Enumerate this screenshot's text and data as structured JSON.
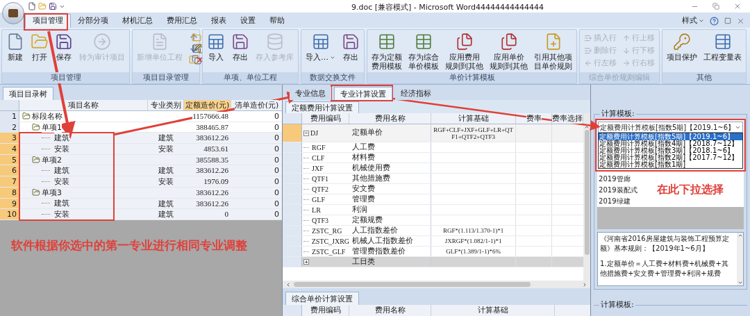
{
  "window": {
    "title": "9.doc [兼容模式] - Microsoft Word44444444444444",
    "style_menu": "样式"
  },
  "menu_tabs": [
    {
      "label": "项目管理",
      "selected": true
    },
    {
      "label": "分部分项",
      "selected": false
    },
    {
      "label": "材机汇总",
      "selected": false
    },
    {
      "label": "费用汇总",
      "selected": false
    },
    {
      "label": "报表",
      "selected": false
    },
    {
      "label": "设置",
      "selected": false
    },
    {
      "label": "帮助",
      "selected": false
    }
  ],
  "ribbon_groups": [
    {
      "label": "项目管理",
      "disabled": false,
      "buttons": [
        {
          "kind": "new",
          "lines": [
            "新建"
          ],
          "disabled": false
        },
        {
          "kind": "open",
          "lines": [
            "打开"
          ],
          "disabled": false
        },
        {
          "kind": "save",
          "lines": [
            "保存"
          ],
          "disabled": false
        },
        {
          "kind": "convert",
          "lines": [
            "转为审计项目"
          ],
          "disabled": true
        }
      ]
    },
    {
      "label": "项目目录管理",
      "disabled": false,
      "buttons": [
        {
          "kind": "new-unit",
          "lines": [
            "新增单位工程"
          ],
          "disabled": true
        }
      ]
    },
    {
      "label": "单项、单位工程",
      "disabled": false,
      "buttons": [
        {
          "kind": "import",
          "lines": [
            "导入"
          ],
          "disabled": false
        },
        {
          "kind": "export",
          "lines": [
            "存出"
          ],
          "disabled": false
        },
        {
          "kind": "library",
          "lines": [
            "存入参考库"
          ],
          "disabled": true
        }
      ]
    },
    {
      "label": "数据交换文件",
      "disabled": false,
      "buttons": [
        {
          "kind": "import",
          "lines": [
            "导入…"
          ],
          "disabled": false,
          "dropdown": true
        },
        {
          "kind": "export",
          "lines": [
            "存出"
          ],
          "disabled": false
        }
      ]
    },
    {
      "label": "单价计算模板",
      "disabled": false,
      "buttons": [
        {
          "kind": "template",
          "lines": [
            "存为定额",
            "费用模板"
          ],
          "disabled": false
        },
        {
          "kind": "template",
          "lines": [
            "存为综合",
            "单价模板"
          ],
          "disabled": false
        },
        {
          "kind": "rule",
          "lines": [
            "应用费用",
            "规则到其他"
          ],
          "disabled": false
        },
        {
          "kind": "rule",
          "lines": [
            "应用单价",
            "规则到其他"
          ],
          "disabled": false
        },
        {
          "kind": "reference",
          "lines": [
            "引用其他项",
            "目单价规则"
          ],
          "disabled": false
        }
      ]
    },
    {
      "label": "综合单价规则编辑",
      "disabled": true,
      "small": [
        {
          "kind": "insert-row",
          "label": "插入行",
          "disabled": true
        },
        {
          "kind": "delete-row",
          "label": "删除行",
          "disabled": true
        },
        {
          "kind": "move-left",
          "label": "行左移",
          "disabled": true
        },
        {
          "kind": "move-up",
          "label": "行上移",
          "disabled": true
        },
        {
          "kind": "move-down",
          "label": "行下移",
          "disabled": true
        },
        {
          "kind": "move-right",
          "label": "行右移",
          "disabled": true
        }
      ]
    },
    {
      "label": "其他",
      "disabled": false,
      "buttons": [
        {
          "kind": "protect",
          "lines": [
            "项目保护"
          ],
          "disabled": false
        },
        {
          "kind": "variables",
          "lines": [
            "工程变量表"
          ],
          "disabled": false
        }
      ]
    }
  ],
  "project_tree": {
    "tab": "项目目录树",
    "columns": [
      "项目名称",
      "专业类别",
      "定额造价(元)",
      "清单造价(元)"
    ],
    "rows": [
      {
        "no": "1",
        "name": "标段名称",
        "quota": "1157666.48",
        "list": "0",
        "selected": false,
        "children": [
          {
            "no": "2",
            "name": "单项1",
            "quota": "388465.87",
            "list": "0",
            "selected": false,
            "children": [
              {
                "no": "3",
                "name": "建筑",
                "type": "建筑",
                "quota": "383612.26",
                "list": "0",
                "selected": true
              },
              {
                "no": "4",
                "name": "安装",
                "type": "安装",
                "quota": "4853.61",
                "list": "0",
                "selected": true
              }
            ]
          },
          {
            "no": "5",
            "name": "单项2",
            "quota": "385588.35",
            "list": "0",
            "selected": true,
            "children": [
              {
                "no": "6",
                "name": "建筑",
                "type": "建筑",
                "quota": "383612.26",
                "list": "0",
                "selected": true
              },
              {
                "no": "7",
                "name": "安装",
                "type": "安装",
                "quota": "1976.09",
                "list": "0",
                "selected": true
              }
            ]
          },
          {
            "no": "8",
            "name": "单项3",
            "quota": "383612.26",
            "list": "0",
            "selected": true,
            "children": [
              {
                "no": "9",
                "name": "建筑",
                "type": "建筑",
                "quota": "383612.26",
                "list": "0",
                "selected": true
              },
              {
                "no": "10",
                "name": "安装",
                "type": "建筑",
                "quota": "0",
                "list": "0",
                "selected": true
              }
            ]
          }
        ]
      }
    ]
  },
  "middle": {
    "tabs": [
      {
        "label": "专业信息",
        "selected": false
      },
      {
        "label": "专业计算设置",
        "selected": true
      },
      {
        "label": "经济指标",
        "selected": false
      }
    ],
    "fee_section": "定额费用计算设置",
    "columns": [
      "费用编码",
      "费用名称",
      "计算基础",
      "费率",
      "费率选择"
    ],
    "rows": [
      {
        "kind": "parent",
        "expanded": true,
        "code": "DJ",
        "name": "定额单价",
        "base": "RGF+CLF+JXF+GLF+LR+QTF1+QTF2+QTF3",
        "selected": true
      },
      {
        "kind": "child",
        "code": "RGF",
        "name": "人工费",
        "base": ""
      },
      {
        "kind": "child",
        "code": "CLF",
        "name": "材料费"
      },
      {
        "kind": "child",
        "code": "JXF",
        "name": "机械使用费"
      },
      {
        "kind": "child",
        "code": "QTF1",
        "name": "其他措施费"
      },
      {
        "kind": "child",
        "code": "QTF2",
        "name": "安文费"
      },
      {
        "kind": "child",
        "code": "GLF",
        "name": "管理费"
      },
      {
        "kind": "child",
        "code": "LR",
        "name": "利润"
      },
      {
        "kind": "child",
        "code": "QTF3",
        "name": "定额规费"
      },
      {
        "kind": "child",
        "code": "ZSTC_RG",
        "name": "人工指数差价",
        "base": "RGF*(1.113/1.370-1)*1"
      },
      {
        "kind": "child",
        "code": "ZSTC_JXRG",
        "name": "机械人工指数差价",
        "base": "JXRGF*(1.082/1-1)*1"
      },
      {
        "kind": "child",
        "code": "ZSTC_GLF",
        "name": "管理费指数差价",
        "base": "GLF*(1.389/1-1)*6%"
      },
      {
        "kind": "category",
        "expanded": false,
        "name": "工日类"
      }
    ],
    "unit_section": "综合单价计算设置",
    "unit_columns": [
      "费用编码",
      "费用名称",
      "计算基础"
    ]
  },
  "template_panel": {
    "label": "计算模板:",
    "combo_value": "定额费用计算模板[指数5期]【2019.1~6】",
    "options": [
      {
        "label": "定额费用计算模板[指数5期]【2019.1~6】",
        "selected": true
      },
      {
        "label": "定额费用计算模板[指数4期]【2018.7~12】",
        "selected": false
      },
      {
        "label": "定额费用计算模板[指数3期]【2018.1~6】",
        "selected": false
      },
      {
        "label": "定额费用计算模板[指数2期]【2017.7~12】",
        "selected": false
      },
      {
        "label": "定额费用计算模板[指数1期]",
        "selected": false
      }
    ],
    "items": [
      "2019管廊",
      "2019装配式",
      "2019绿建"
    ],
    "description": [
      "《河南省2016房屋建筑与装饰工程预算定额》基本规则：【2019年1~6月】",
      "1.定额单价＝人工费+材料费+机械费+其他措施费+安文费+管理费+利润+规费"
    ],
    "bottom_label": "计算模板:"
  },
  "annotations": {
    "left_note": "软件根据你选中的第一专业进行相同专业调整",
    "right_note": "在此下拉选择"
  }
}
